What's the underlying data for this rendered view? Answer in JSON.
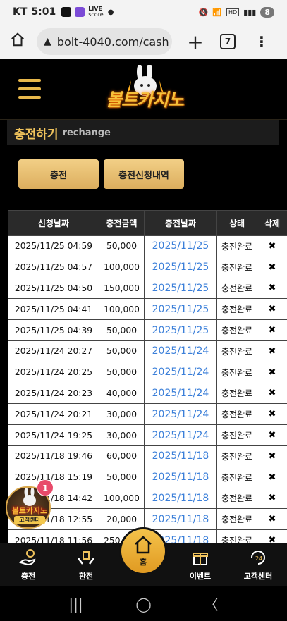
{
  "status_bar": {
    "carrier": "KT",
    "time": "5:01",
    "battery": "8",
    "live_label": "LIVE",
    "live_sub": "score"
  },
  "browser": {
    "url": "bolt-4040.com/cash",
    "tab_count": "7"
  },
  "site": {
    "logo_text": "볼트카지노"
  },
  "page": {
    "title": "충전하기",
    "subtitle": "rechange"
  },
  "buttons": {
    "charge": "충전",
    "charge_history": "충전신청내역"
  },
  "table": {
    "headers": [
      "신청날짜",
      "충전금액",
      "충전날짜",
      "상태",
      "삭제"
    ],
    "rows": [
      [
        "2025/11/25 04:59",
        "50,000",
        "2025/11/25",
        "충전완료",
        "✖"
      ],
      [
        "2025/11/25 04:57",
        "100,000",
        "2025/11/25",
        "충전완료",
        "✖"
      ],
      [
        "2025/11/25 04:50",
        "150,000",
        "2025/11/25",
        "충전완료",
        "✖"
      ],
      [
        "2025/11/25 04:41",
        "100,000",
        "2025/11/25",
        "충전완료",
        "✖"
      ],
      [
        "2025/11/25 04:39",
        "50,000",
        "2025/11/25",
        "충전완료",
        "✖"
      ],
      [
        "2025/11/24 20:27",
        "50,000",
        "2025/11/24",
        "충전완료",
        "✖"
      ],
      [
        "2025/11/24 20:25",
        "50,000",
        "2025/11/24",
        "충전완료",
        "✖"
      ],
      [
        "2025/11/24 20:23",
        "40,000",
        "2025/11/24",
        "충전완료",
        "✖"
      ],
      [
        "2025/11/24 20:21",
        "30,000",
        "2025/11/24",
        "충전완료",
        "✖"
      ],
      [
        "2025/11/24 19:25",
        "30,000",
        "2025/11/24",
        "충전완료",
        "✖"
      ],
      [
        "2025/11/18 19:46",
        "60,000",
        "2025/11/18",
        "충전완료",
        "✖"
      ],
      [
        "2025/11/18 15:19",
        "50,000",
        "2025/11/18",
        "충전완료",
        "✖"
      ],
      [
        "2025/11/18 14:42",
        "100,000",
        "2025/11/18",
        "충전완료",
        "✖"
      ],
      [
        "2025/11/18 12:55",
        "20,000",
        "2025/11/18",
        "충전완료",
        "✖"
      ],
      [
        "2025/11/18 11:56",
        "250,000",
        "2025/11/18",
        "충전완료",
        "✖"
      ]
    ]
  },
  "floating_chat": {
    "logo_text": "볼트카지노",
    "label": "고객센터",
    "badge": "1"
  },
  "bottom_nav": {
    "charge": "충전",
    "exchange": "환전",
    "home": "홈",
    "event": "이벤트",
    "support": "고객센터"
  }
}
